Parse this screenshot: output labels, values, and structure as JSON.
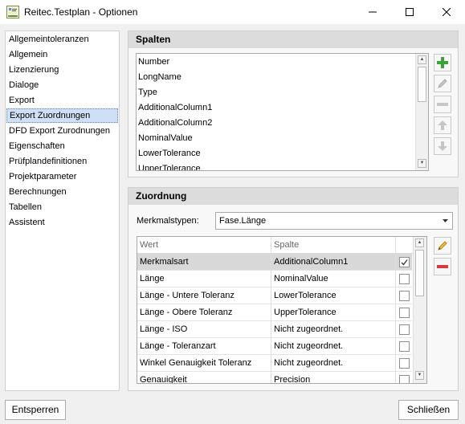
{
  "window": {
    "title": "Reitec.Testplan - Optionen",
    "icon": "reitec-app-icon"
  },
  "nav": {
    "items": [
      {
        "label": "Allgemeintoleranzen"
      },
      {
        "label": "Allgemein"
      },
      {
        "label": "Lizenzierung"
      },
      {
        "label": "Dialoge"
      },
      {
        "label": "Export"
      },
      {
        "label": "Export Zuordnungen",
        "selected": true
      },
      {
        "label": "DFD Export Zurodnungen"
      },
      {
        "label": "Eigenschaften"
      },
      {
        "label": "Prüfplandefinitionen"
      },
      {
        "label": "Projektparameter"
      },
      {
        "label": "Berechnungen"
      },
      {
        "label": "Tabellen"
      },
      {
        "label": "Assistent"
      }
    ]
  },
  "spalten": {
    "title": "Spalten",
    "items": [
      "Number",
      "LongName",
      "Type",
      "AdditionalColumn1",
      "AdditionalColumn2",
      "NominalValue",
      "LowerTolerance",
      "UpperTolerance"
    ],
    "buttons": {
      "add": "plus-icon",
      "edit": "pencil-icon",
      "remove": "minus-icon",
      "up": "arrow-up-icon",
      "down": "arrow-down-icon"
    }
  },
  "zuordnung": {
    "title": "Zuordnung",
    "merkmalstypen_label": "Merkmalstypen:",
    "merkmalstypen_value": "Fase.Länge",
    "columns": {
      "wert": "Wert",
      "spalte": "Spalte"
    },
    "rows": [
      {
        "wert": "Merkmalsart",
        "spalte": "AdditionalColumn1",
        "checked": true,
        "selected": true
      },
      {
        "wert": "Länge",
        "spalte": "NominalValue",
        "checked": false
      },
      {
        "wert": "Länge - Untere Toleranz",
        "spalte": "LowerTolerance",
        "checked": false
      },
      {
        "wert": "Länge - Obere Toleranz",
        "spalte": "UpperTolerance",
        "checked": false
      },
      {
        "wert": "Länge - ISO",
        "spalte": "Nicht zugeordnet.",
        "checked": false
      },
      {
        "wert": "Länge - Toleranzart",
        "spalte": "Nicht zugeordnet.",
        "checked": false
      },
      {
        "wert": "Winkel Genauigkeit Toleranz",
        "spalte": "Nicht zugeordnet.",
        "checked": false
      },
      {
        "wert": "Genauigkeit",
        "spalte": "Precision",
        "checked": false
      }
    ]
  },
  "footer": {
    "unlock_label": "Entsperren",
    "close_label": "Schließen"
  },
  "colors": {
    "accent_add": "#3aa335",
    "accent_remove": "#d63b3b",
    "selection": "#cfe0f5"
  }
}
